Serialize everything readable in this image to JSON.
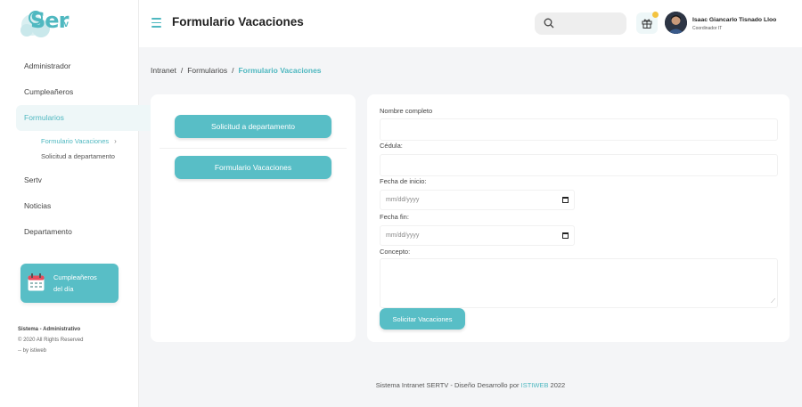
{
  "brand": {
    "logo_main": "Ser",
    "logo_sub": "tv",
    "accent": "#4fb8c0"
  },
  "sidebar": {
    "items": [
      {
        "label": "Administrador"
      },
      {
        "label": "Cumpleañeros"
      },
      {
        "label": "Formularios"
      },
      {
        "label": "Sertv"
      },
      {
        "label": "Noticias"
      },
      {
        "label": "Departamento"
      }
    ],
    "subitems": [
      {
        "label": "Formulario Vacaciones"
      },
      {
        "label": "Solicitud a departamento"
      }
    ],
    "birthday_card": {
      "line1": "Cumpleañeros",
      "line2": "del día"
    },
    "system": {
      "title": "Sistema - Administrativo",
      "copyright": "© 2020 All Rights Reserved",
      "by": "-- by istiweb"
    }
  },
  "header": {
    "title": "Formulario Vacaciones",
    "user_name": "Isaac Giancarlo Tisnado Lloo",
    "user_role": "Coordinador IT"
  },
  "breadcrumb": [
    "Intranet",
    "Formularios",
    "Formulario Vacaciones"
  ],
  "left_panel": {
    "buttons": [
      "Solicitud a departamento",
      "Formulario Vacaciones"
    ]
  },
  "form": {
    "name_label": "Nombre completo",
    "id_label": "Cédula:",
    "start_label": "Fecha de inicio:",
    "start_placeholder": "mm/dd/yyyy",
    "end_label": "Fecha fin:",
    "end_placeholder": "mm/dd/yyyy",
    "concept_label": "Concepto:",
    "submit_label": "Solicitar Vacaciones"
  },
  "footer": {
    "prefix": "Sistema Intranet SERTV - Diseño Desarrollo por",
    "brand": "ISTIWEB",
    "year": "2022"
  }
}
